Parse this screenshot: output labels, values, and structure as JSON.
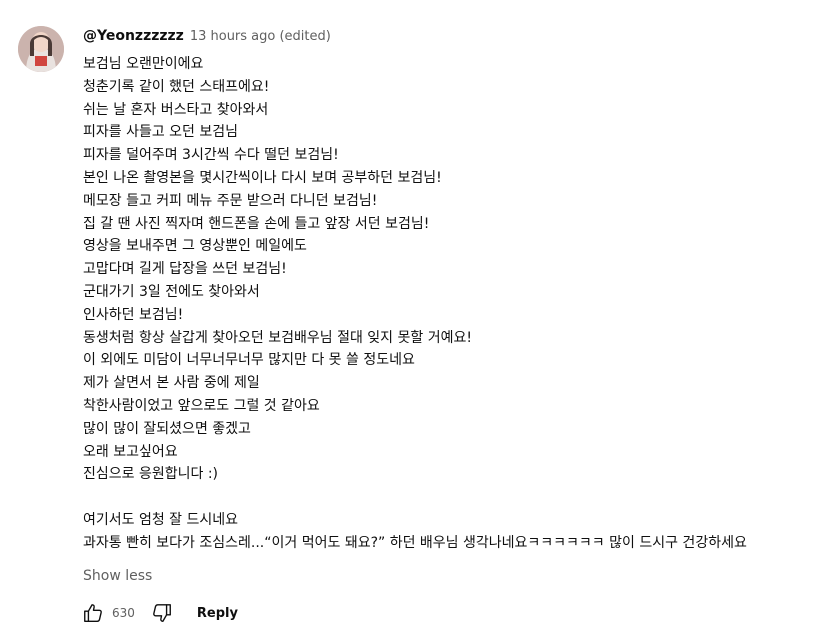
{
  "comment": {
    "author": "@Yeonzzzzzz",
    "timestamp": "13 hours ago (edited)",
    "lines": [
      "보검님 오랜만이에요",
      "청춘기록 같이 했던 스태프에요!",
      "쉬는 날 혼자 버스타고 찾아와서",
      "피자를 사들고 오던 보검님",
      "피자를 덜어주며 3시간씩 수다 떨던 보검님!",
      "본인 나온 촬영본을 몇시간씩이나 다시 보며 공부하던 보검님!",
      "메모장 들고 커피 메뉴 주문 받으러 다니던 보검님!",
      "집 갈 땐 사진 찍자며 핸드폰을 손에 들고 앞장 서던 보검님!",
      "영상을 보내주면 그 영상뿐인 메일에도",
      "고맙다며 길게 답장을 쓰던 보검님!",
      "군대가기 3일 전에도 찾아와서",
      "인사하던 보검님!",
      "동생처럼 항상 살갑게 찾아오던 보검배우님 절대 잊지 못할 거예요!",
      "이 외에도 미담이 너무너무너무 많지만 다 못 쓸 정도네요",
      "제가 살면서 본 사람 중에 제일",
      "착한사람이었고 앞으로도 그럴 것 같아요",
      "많이 많이 잘되셨으면 좋겠고",
      "오래 보고싶어요",
      "진심으로 응원합니다 :)",
      "",
      "여기서도 엄청 잘 드시네요",
      "과자통 빤히 보다가 조심스레...“이거 먹어도 돼요?” 하던 배우님 생각나네요ㅋㅋㅋㅋㅋㅋ 많이 드시구 건강하세요"
    ],
    "show_less_label": "Show less",
    "like_count": "630",
    "reply_label": "Reply"
  },
  "icons": {
    "avatar": "avatar-photo",
    "like": "thumbs-up-icon",
    "dislike": "thumbs-down-icon"
  }
}
